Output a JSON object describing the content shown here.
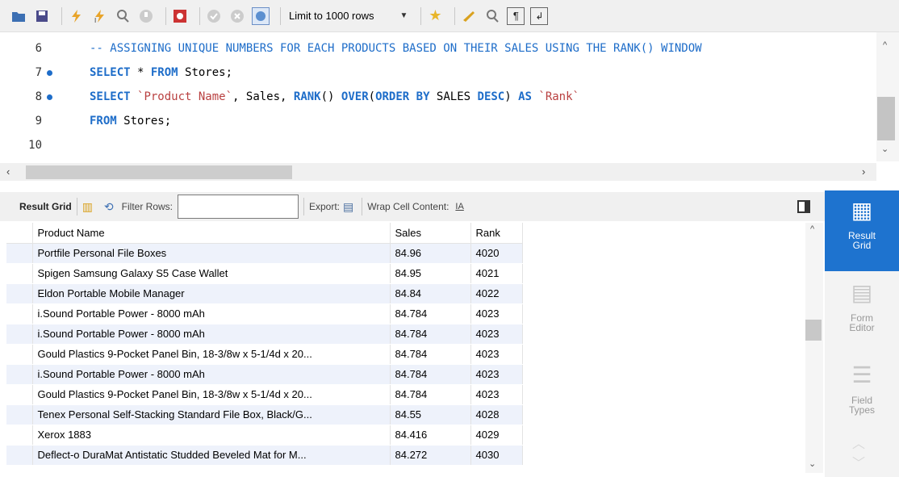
{
  "toolbar": {
    "limit_label": "Limit to 1000 rows",
    "icons": [
      "folder-icon",
      "save-icon",
      "execute-icon",
      "execute-current-icon",
      "explain-icon",
      "stop-icon",
      "toggle-error-icon",
      "commit-icon",
      "rollback-icon",
      "autocommit-icon",
      "bookmark-icon",
      "beautify-icon",
      "find-icon",
      "invisibles-icon",
      "wrap-icon"
    ]
  },
  "editor": {
    "lines": [
      {
        "num": "6",
        "text": "-- ASSIGNING UNIQUE NUMBERS FOR EACH PRODUCTS BASED ON THEIR SALES USING THE RANK() WINDOW"
      },
      {
        "num": "7",
        "kw1": "SELECT",
        "plain1": " * ",
        "kw2": "FROM",
        "plain2": " Stores;"
      },
      {
        "num": "8",
        "kw1": "SELECT",
        "str1": "`Product Name`",
        "plain1": ", Sales, ",
        "kw2": "RANK",
        "plain2": "() ",
        "kw3": "OVER",
        "plain3": "(",
        "kw4": "ORDER BY",
        "plain4": " SALES ",
        "kw5": "DESC",
        "plain5": ") ",
        "kw6": "AS",
        "str2": "`Rank`"
      },
      {
        "num": "9",
        "kw1": "FROM",
        "plain1": " Stores;"
      },
      {
        "num": "10"
      }
    ]
  },
  "result_toolbar": {
    "result_grid_label": "Result Grid",
    "filter_label": "Filter Rows:",
    "filter_value": "",
    "export_label": "Export:",
    "wrap_label": "Wrap Cell Content:"
  },
  "grid": {
    "columns": [
      "Product Name",
      "Sales",
      "Rank"
    ],
    "rows": [
      [
        "Portfile Personal File Boxes",
        "84.96",
        "4020"
      ],
      [
        "Spigen Samsung Galaxy S5 Case Wallet",
        "84.95",
        "4021"
      ],
      [
        "Eldon Portable Mobile Manager",
        "84.84",
        "4022"
      ],
      [
        "i.Sound Portable Power - 8000 mAh",
        "84.784",
        "4023"
      ],
      [
        "i.Sound Portable Power - 8000 mAh",
        "84.784",
        "4023"
      ],
      [
        "Gould Plastics 9-Pocket Panel Bin, 18-3/8w x 5-1/4d x 20...",
        "84.784",
        "4023"
      ],
      [
        "i.Sound Portable Power - 8000 mAh",
        "84.784",
        "4023"
      ],
      [
        "Gould Plastics 9-Pocket Panel Bin, 18-3/8w x 5-1/4d x 20...",
        "84.784",
        "4023"
      ],
      [
        "Tenex Personal Self-Stacking Standard File Box, Black/G...",
        "84.55",
        "4028"
      ],
      [
        "Xerox 1883",
        "84.416",
        "4029"
      ],
      [
        "Deflect-o DuraMat Antistatic Studded Beveled Mat for M...",
        "84.272",
        "4030"
      ]
    ]
  },
  "sidebar": {
    "result_grid": "Result\nGrid",
    "form_editor": "Form\nEditor",
    "field_types": "Field\nTypes"
  },
  "colors": {
    "accent": "#1e73cf",
    "keyword": "#1e6dc9",
    "string": "#b94040",
    "row_alt": "#eef2fb"
  }
}
